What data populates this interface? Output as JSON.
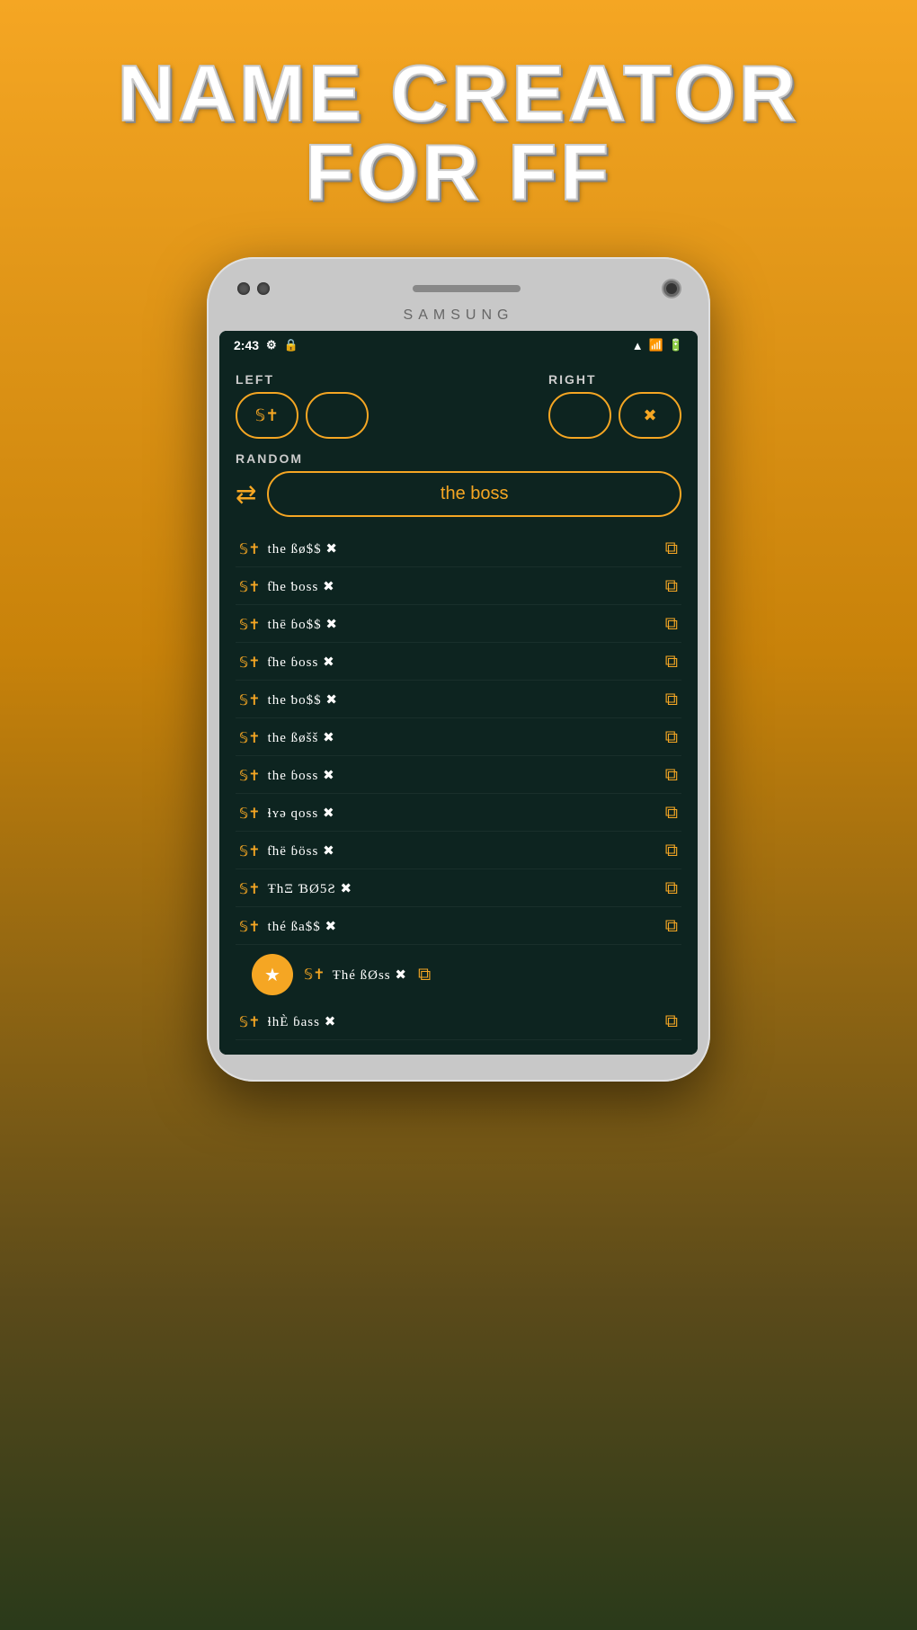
{
  "title": {
    "line1": "NAME CREATOR",
    "line2": "FOR FF"
  },
  "phone": {
    "brand": "SAMSUNG",
    "status": {
      "time": "2:43",
      "icons_left": [
        "⚙",
        "🔋"
      ],
      "icons_right": [
        "▲",
        "📶",
        "🔋"
      ]
    }
  },
  "ui": {
    "left_label": "LEFT",
    "right_label": "RIGHT",
    "random_label": "RANDOM",
    "name_value": "the boss"
  },
  "results": [
    {
      "id": 1,
      "text": "the ßø$$ ✖"
    },
    {
      "id": 2,
      "text": "ƭhe ƅoss ✖"
    },
    {
      "id": 3,
      "text": "thē ɓo$$ ✖"
    },
    {
      "id": 4,
      "text": "ƭhe ɓoss ✖"
    },
    {
      "id": 5,
      "text": "the ƅo$$ ✖"
    },
    {
      "id": 6,
      "text": "the ßøšš ✖"
    },
    {
      "id": 7,
      "text": "the ɓoss ✖"
    },
    {
      "id": 8,
      "text": "ɬʏǝ qoss ✖"
    },
    {
      "id": 9,
      "text": "ƭhë ɓöss ✖"
    },
    {
      "id": 10,
      "text": "ŦhΞ ƁØ5Ƨ ✖"
    },
    {
      "id": 11,
      "text": "thé ßa$$ ✖"
    },
    {
      "id": 12,
      "text": "Ŧhé ßØss ✖"
    },
    {
      "id": 13,
      "text": "ɬhÈ ɓass ✖"
    }
  ],
  "copy_icon": "⧉",
  "shuffle_icon": "⇄",
  "star_icon": "★"
}
